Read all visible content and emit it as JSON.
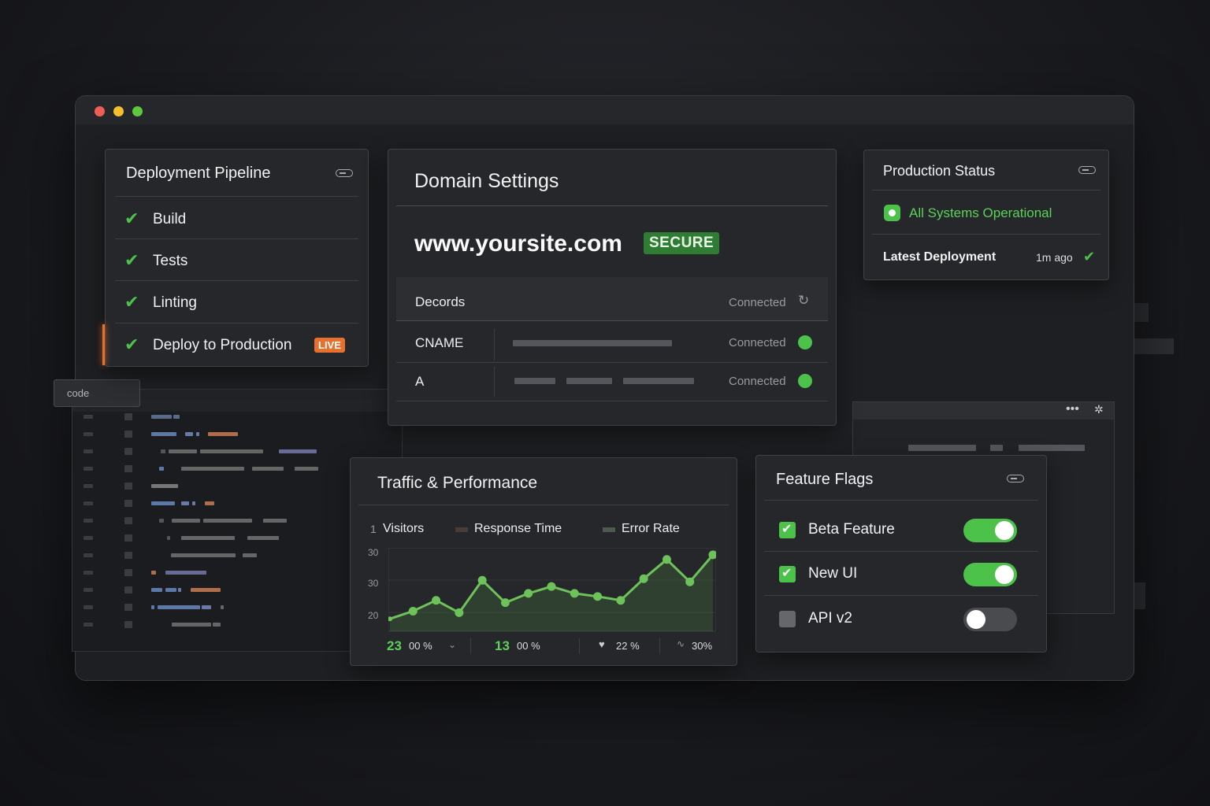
{
  "window": {
    "traffic_lights": [
      "#ec5f57",
      "#f5be2d",
      "#5fc73f"
    ]
  },
  "pipeline": {
    "title": "Deployment Pipeline",
    "steps": [
      {
        "label": "Build",
        "status": "done"
      },
      {
        "label": "Tests",
        "status": "done"
      },
      {
        "label": "Linting",
        "status": "done"
      },
      {
        "label": "Deploy to Production",
        "status": "done",
        "badge": "LIVE"
      }
    ]
  },
  "domain": {
    "title": "Domain Settings",
    "hostname": "www.yoursite.com",
    "secure_badge": "SECURE",
    "records_header": "Decords",
    "records_header_status": "Connected",
    "records": [
      {
        "type": "CNAME",
        "status": "Connected"
      },
      {
        "type": "A",
        "status": "Connected"
      }
    ]
  },
  "production": {
    "title": "Production Status",
    "status_text": "All Systems Operational",
    "latest_label": "Latest Deployment",
    "latest_time": "1m ago"
  },
  "code_tab": {
    "label": "code"
  },
  "traffic": {
    "title": "Traffic & Performance",
    "legend": [
      {
        "prefix": "1",
        "label": "Visitors"
      },
      {
        "label": "Response Time"
      },
      {
        "label": "Error Rate"
      }
    ],
    "stats": [
      {
        "value": "23",
        "text": "00 %"
      },
      {
        "value": "13",
        "text": "00 %"
      },
      {
        "value": "",
        "text": "22 %"
      },
      {
        "value": "",
        "text": "30%"
      }
    ]
  },
  "chart_data": {
    "type": "area",
    "title": "",
    "xlabel": "",
    "ylabel": "",
    "yticks": [
      "30",
      "30",
      "20"
    ],
    "series": [
      {
        "values": [
          0.12,
          0.22,
          0.36,
          0.2,
          0.62,
          0.33,
          0.45,
          0.54,
          0.45,
          0.41,
          0.36,
          0.64,
          0.89,
          0.6,
          0.95
        ]
      }
    ],
    "color": "#6ec25a"
  },
  "flags": {
    "title": "Feature Flags",
    "items": [
      {
        "label": "Beta Feature",
        "enabled": true
      },
      {
        "label": "New UI",
        "enabled": true
      },
      {
        "label": "API v2",
        "enabled": false
      }
    ]
  },
  "colors": {
    "accent_green": "#4cc24a",
    "accent_orange": "#e8702e",
    "panel": "#26272b"
  }
}
